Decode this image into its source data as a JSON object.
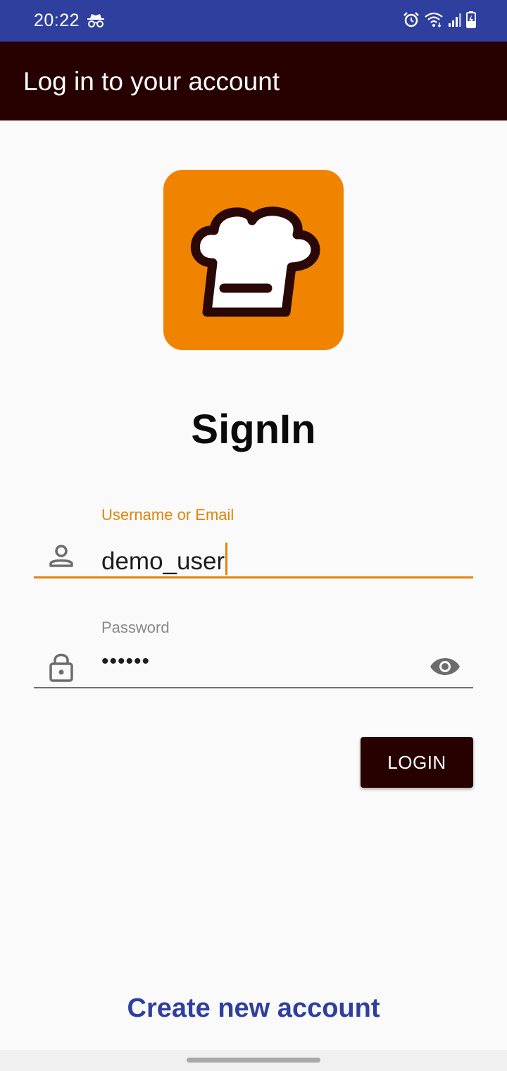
{
  "status_bar": {
    "time": "20:22",
    "icons": [
      "incognito-icon",
      "alarm-icon",
      "wifi-icon",
      "signal-icon",
      "battery-charging-icon"
    ]
  },
  "app_bar": {
    "title": "Log in to your account"
  },
  "logo": {
    "icon": "chef-hat-icon",
    "background": "#f08400"
  },
  "heading": "SignIn",
  "username_field": {
    "label": "Username or Email",
    "value": "demo_user",
    "icon": "person-icon",
    "accent_color": "#e2840c"
  },
  "password_field": {
    "label": "Password",
    "value": "••••••",
    "icon": "lock-icon",
    "toggle_icon": "eye-icon"
  },
  "login_button": {
    "label": "LOGIN"
  },
  "create_account_link": "Create new account",
  "colors": {
    "status_bar": "#2f3f9e",
    "app_bar": "#270000",
    "link": "#2f3f9e"
  }
}
